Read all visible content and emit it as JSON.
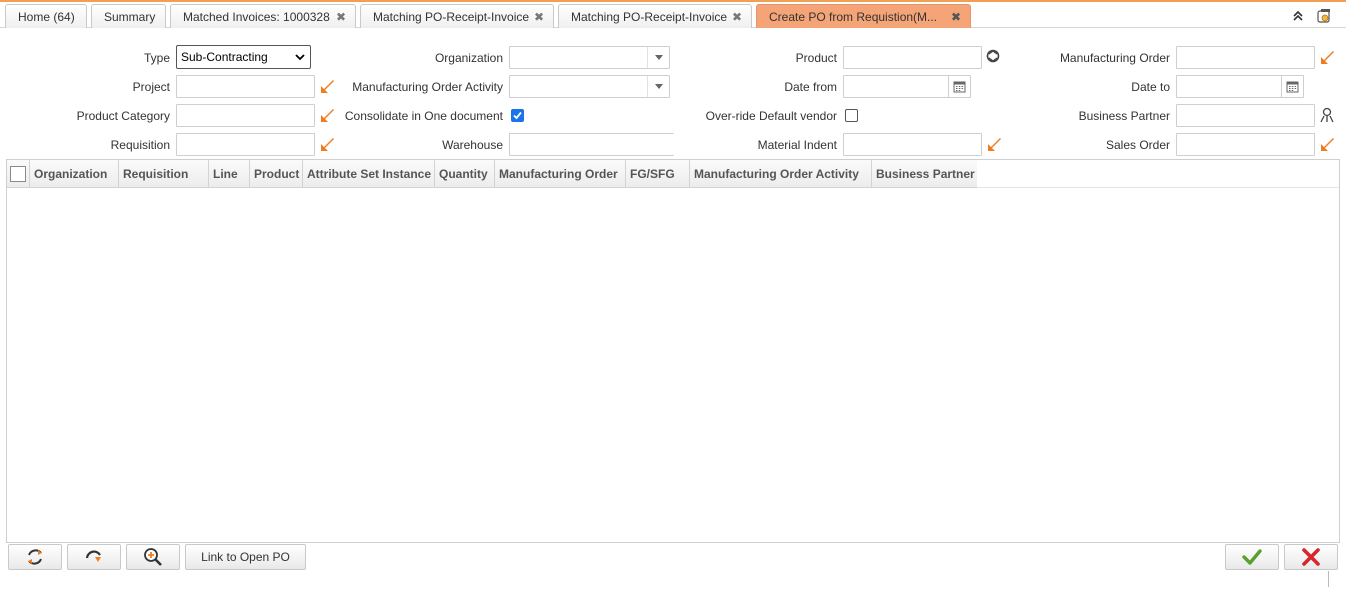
{
  "tabs": [
    {
      "label": "Home (64)",
      "closable": false
    },
    {
      "label": "Summary",
      "closable": false
    },
    {
      "label": "Matched Invoices: 1000328",
      "closable": true
    },
    {
      "label": "Matching PO-Receipt-Invoice",
      "closable": true
    },
    {
      "label": "Matching PO-Receipt-Invoice",
      "closable": true
    },
    {
      "label": "Create PO from Requistion(M...",
      "closable": true,
      "active": true
    }
  ],
  "close_glyph": "✖",
  "form": {
    "type_label": "Type",
    "type_value": "Sub-Contracting",
    "project_label": "Project",
    "product_category_label": "Product Category",
    "requisition_label": "Requisition",
    "organization_label": "Organization",
    "mo_activity_label": "Manufacturing Order Activity",
    "consolidate_label": "Consolidate in One document",
    "consolidate_checked": true,
    "warehouse_label": "Warehouse",
    "product_label": "Product",
    "date_from_label": "Date from",
    "override_vendor_label": "Over-ride Default vendor",
    "override_vendor_checked": false,
    "material_indent_label": "Material Indent",
    "manufacturing_order_label": "Manufacturing Order",
    "date_to_label": "Date to",
    "business_partner_label": "Business Partner",
    "sales_order_label": "Sales Order"
  },
  "grid": {
    "columns": [
      "Organization",
      "Requisition",
      "Line",
      "Product",
      "Attribute Set Instance",
      "Quantity",
      "Manufacturing Order",
      "FG/SFG",
      "Manufacturing Order Activity",
      "Business Partner"
    ]
  },
  "buttons": {
    "link_open_po": "Link to Open PO"
  },
  "colors": {
    "active_tab": "#f4a476",
    "accent_orange": "#f07c1e",
    "ok_green": "#5aa02c",
    "cancel_red": "#d9262c",
    "checkbox_blue": "#1a73e8"
  },
  "icons": [
    "collapse-icon",
    "window-icon",
    "search-icon",
    "product-search-icon",
    "calendar-icon",
    "business-partner-icon",
    "refresh-icon",
    "redo-icon",
    "zoom-icon",
    "ok-icon",
    "cancel-icon"
  ]
}
